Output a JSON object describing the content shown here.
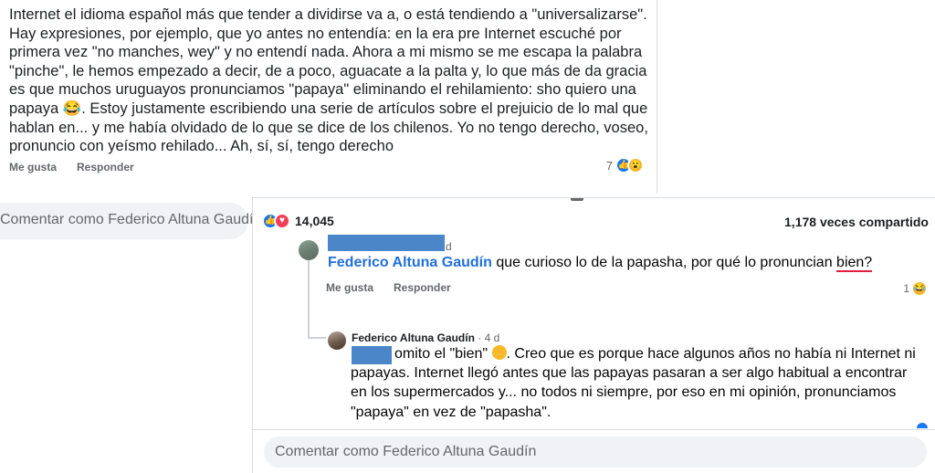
{
  "top_comment": {
    "text": "Internet el idioma español más que tender a dividirse va a, o está tendiendo a \"universalizarse\". Hay expresiones, por ejemplo, que yo antes no entendía: en la era pre Internet escuché por primera vez \"no manches, wey\" y no entendí nada. Ahora a mi mismo se me escapa la palabra \"pinche\", le hemos empezado a decir, de a poco, aguacate a la palta y, lo que más de da gracia es que muchos uruguayos pronunciamos \"papaya\" eliminando el rehilamiento: sho quiero una papaya 😂. Estoy justamente escribiendo una serie de artículos sobre el prejuicio de lo mal que hablan en... y me había olvidado de lo que se dice de los chilenos. Yo no tengo derecho, voseo, pronuncio con yeísmo rehilado... Ah, sí, sí, tengo derecho",
    "like_label": "Me gusta",
    "reply_label": "Responder",
    "reaction_count": "7"
  },
  "left_composer": {
    "placeholder": "Comentar como Federico Altuna Gaudín"
  },
  "post": {
    "reaction_count": "14,045",
    "shares": "1,178 veces compartido"
  },
  "comment_1": {
    "time": "d",
    "author": "Federico Altuna Gaudín",
    "text_before": "que curioso lo de la papasha, por qué lo pronuncian",
    "highlighted_word": "bien?",
    "like_label": "Me gusta",
    "reply_label": "Responder",
    "reaction_count": "1"
  },
  "reply_1": {
    "author": "Federico Altuna Gaudín",
    "time": "4 d",
    "text_part1": "omito el \"bien\"",
    "text_part2": ". Creo que es porque hace algunos años no había ni Internet ni papayas. Internet llegó antes que las papayas pasaran a ser algo habitual a encontrar en los supermercados y... no todos ni siempre, por eso en mi opinión, pronunciamos \"papaya\" en vez de \"papasha\"."
  },
  "composer": {
    "placeholder": "Comentar como Federico Altuna Gaudín"
  },
  "colors": {
    "link_blue": "#216fdb",
    "like_blue": "#1877f2",
    "love_red": "#f33e58",
    "haha_yellow": "#f7b928",
    "redaction_blue": "#4a86c8",
    "secondary_text": "#65676b",
    "input_bg": "#f0f2f5"
  },
  "icons": {
    "like": "like-icon",
    "love": "love-icon",
    "haha": "haha-icon",
    "wow": "wow-icon"
  }
}
